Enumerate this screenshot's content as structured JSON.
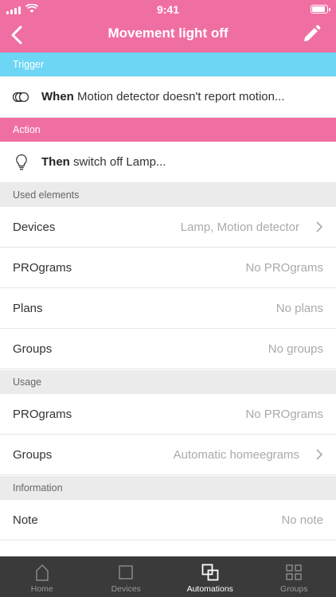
{
  "status": {
    "time": "9:41"
  },
  "header": {
    "title": "Movement light off"
  },
  "trigger": {
    "section_label": "Trigger",
    "keyword": "When",
    "text": " Motion detector doesn't report motion..."
  },
  "action": {
    "section_label": "Action",
    "keyword": "Then",
    "text": " switch off Lamp..."
  },
  "used_elements": {
    "section_label": "Used elements",
    "rows": [
      {
        "label": "Devices",
        "value": "Lamp, Motion detector"
      },
      {
        "label": "PROgrams",
        "value": "No PROgrams"
      },
      {
        "label": "Plans",
        "value": "No plans"
      },
      {
        "label": "Groups",
        "value": "No groups"
      }
    ]
  },
  "usage": {
    "section_label": "Usage",
    "rows": [
      {
        "label": "PROgrams",
        "value": "No PROgrams"
      },
      {
        "label": "Groups",
        "value": "Automatic homeegrams"
      }
    ]
  },
  "information": {
    "section_label": "Information",
    "rows": [
      {
        "label": "Note",
        "value": "No note"
      }
    ]
  },
  "tabs": [
    {
      "label": "Home",
      "icon": "home-icon"
    },
    {
      "label": "Devices",
      "icon": "devices-icon"
    },
    {
      "label": "Automations",
      "icon": "automations-icon",
      "active": true
    },
    {
      "label": "Groups",
      "icon": "groups-icon"
    }
  ],
  "colors": {
    "accent": "#f06fa3",
    "trigger": "#6cd6f4",
    "tabbar": "#3a3a3a"
  }
}
